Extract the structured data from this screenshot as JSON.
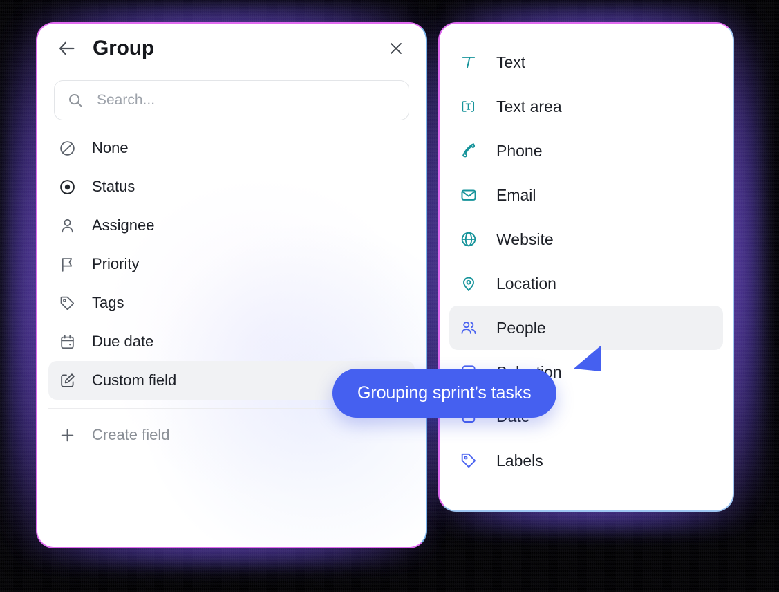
{
  "colors": {
    "tooltip_blue": "#4560f0",
    "teal_icon": "#17949b",
    "blue_icon": "#4a63f0",
    "panel_border_magenta": "#e06bf0",
    "panel_border_blue": "#7ab4ec",
    "selected_row_bg": "#f1f2f4",
    "muted_text": "#8b9097"
  },
  "group_panel": {
    "title": "Group",
    "back_icon": "arrow-left-icon",
    "close_icon": "close-icon",
    "search": {
      "placeholder": "Search...",
      "value": "",
      "icon": "search-icon"
    },
    "items": [
      {
        "label": "None",
        "icon": "no-entry-icon",
        "selected": false,
        "muted": false,
        "chevron": false
      },
      {
        "label": "Status",
        "icon": "target-icon",
        "selected": false,
        "muted": false,
        "chevron": false
      },
      {
        "label": "Assignee",
        "icon": "user-icon",
        "selected": false,
        "muted": false,
        "chevron": false
      },
      {
        "label": "Priority",
        "icon": "flag-icon",
        "selected": false,
        "muted": false,
        "chevron": false
      },
      {
        "label": "Tags",
        "icon": "tag-icon",
        "selected": false,
        "muted": false,
        "chevron": false
      },
      {
        "label": "Due date",
        "icon": "calendar-icon",
        "selected": false,
        "muted": false,
        "chevron": false
      },
      {
        "label": "Custom field",
        "icon": "edit-square-icon",
        "selected": true,
        "muted": false,
        "chevron": true
      }
    ],
    "footer": {
      "label": "Create field",
      "icon": "plus-icon"
    }
  },
  "field_type_panel": {
    "items": [
      {
        "label": "Text",
        "icon": "text-t-icon",
        "color": "teal",
        "selected": false
      },
      {
        "label": "Text area",
        "icon": "text-area-icon",
        "color": "teal",
        "selected": false
      },
      {
        "label": "Phone",
        "icon": "phone-icon",
        "color": "teal",
        "selected": false
      },
      {
        "label": "Email",
        "icon": "envelope-icon",
        "color": "teal",
        "selected": false
      },
      {
        "label": "Website",
        "icon": "globe-icon",
        "color": "teal",
        "selected": false
      },
      {
        "label": "Location",
        "icon": "map-pin-icon",
        "color": "teal",
        "selected": false
      },
      {
        "label": "People",
        "icon": "people-icon",
        "color": "blue",
        "selected": true
      },
      {
        "label": "Selection",
        "icon": "selection-icon",
        "color": "blue",
        "selected": false
      },
      {
        "label": "Date",
        "icon": "date-icon",
        "color": "blue",
        "selected": false
      },
      {
        "label": "Labels",
        "icon": "label-tag-icon",
        "color": "blue",
        "selected": false
      }
    ]
  },
  "tooltip": {
    "text": "Grouping sprint’s tasks"
  }
}
